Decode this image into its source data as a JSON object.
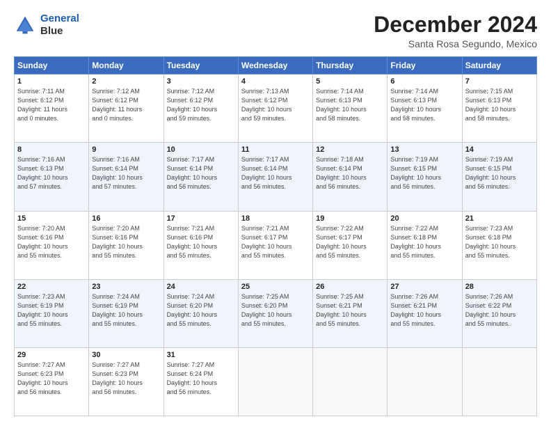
{
  "header": {
    "logo_line1": "General",
    "logo_line2": "Blue",
    "month_title": "December 2024",
    "location": "Santa Rosa Segundo, Mexico"
  },
  "days_of_week": [
    "Sunday",
    "Monday",
    "Tuesday",
    "Wednesday",
    "Thursday",
    "Friday",
    "Saturday"
  ],
  "weeks": [
    [
      {
        "day": "1",
        "info": "Sunrise: 7:11 AM\nSunset: 6:12 PM\nDaylight: 11 hours\nand 0 minutes."
      },
      {
        "day": "2",
        "info": "Sunrise: 7:12 AM\nSunset: 6:12 PM\nDaylight: 11 hours\nand 0 minutes."
      },
      {
        "day": "3",
        "info": "Sunrise: 7:12 AM\nSunset: 6:12 PM\nDaylight: 10 hours\nand 59 minutes."
      },
      {
        "day": "4",
        "info": "Sunrise: 7:13 AM\nSunset: 6:12 PM\nDaylight: 10 hours\nand 59 minutes."
      },
      {
        "day": "5",
        "info": "Sunrise: 7:14 AM\nSunset: 6:13 PM\nDaylight: 10 hours\nand 58 minutes."
      },
      {
        "day": "6",
        "info": "Sunrise: 7:14 AM\nSunset: 6:13 PM\nDaylight: 10 hours\nand 58 minutes."
      },
      {
        "day": "7",
        "info": "Sunrise: 7:15 AM\nSunset: 6:13 PM\nDaylight: 10 hours\nand 58 minutes."
      }
    ],
    [
      {
        "day": "8",
        "info": "Sunrise: 7:16 AM\nSunset: 6:13 PM\nDaylight: 10 hours\nand 57 minutes."
      },
      {
        "day": "9",
        "info": "Sunrise: 7:16 AM\nSunset: 6:14 PM\nDaylight: 10 hours\nand 57 minutes."
      },
      {
        "day": "10",
        "info": "Sunrise: 7:17 AM\nSunset: 6:14 PM\nDaylight: 10 hours\nand 56 minutes."
      },
      {
        "day": "11",
        "info": "Sunrise: 7:17 AM\nSunset: 6:14 PM\nDaylight: 10 hours\nand 56 minutes."
      },
      {
        "day": "12",
        "info": "Sunrise: 7:18 AM\nSunset: 6:14 PM\nDaylight: 10 hours\nand 56 minutes."
      },
      {
        "day": "13",
        "info": "Sunrise: 7:19 AM\nSunset: 6:15 PM\nDaylight: 10 hours\nand 56 minutes."
      },
      {
        "day": "14",
        "info": "Sunrise: 7:19 AM\nSunset: 6:15 PM\nDaylight: 10 hours\nand 56 minutes."
      }
    ],
    [
      {
        "day": "15",
        "info": "Sunrise: 7:20 AM\nSunset: 6:16 PM\nDaylight: 10 hours\nand 55 minutes."
      },
      {
        "day": "16",
        "info": "Sunrise: 7:20 AM\nSunset: 6:16 PM\nDaylight: 10 hours\nand 55 minutes."
      },
      {
        "day": "17",
        "info": "Sunrise: 7:21 AM\nSunset: 6:16 PM\nDaylight: 10 hours\nand 55 minutes."
      },
      {
        "day": "18",
        "info": "Sunrise: 7:21 AM\nSunset: 6:17 PM\nDaylight: 10 hours\nand 55 minutes."
      },
      {
        "day": "19",
        "info": "Sunrise: 7:22 AM\nSunset: 6:17 PM\nDaylight: 10 hours\nand 55 minutes."
      },
      {
        "day": "20",
        "info": "Sunrise: 7:22 AM\nSunset: 6:18 PM\nDaylight: 10 hours\nand 55 minutes."
      },
      {
        "day": "21",
        "info": "Sunrise: 7:23 AM\nSunset: 6:18 PM\nDaylight: 10 hours\nand 55 minutes."
      }
    ],
    [
      {
        "day": "22",
        "info": "Sunrise: 7:23 AM\nSunset: 6:19 PM\nDaylight: 10 hours\nand 55 minutes."
      },
      {
        "day": "23",
        "info": "Sunrise: 7:24 AM\nSunset: 6:19 PM\nDaylight: 10 hours\nand 55 minutes."
      },
      {
        "day": "24",
        "info": "Sunrise: 7:24 AM\nSunset: 6:20 PM\nDaylight: 10 hours\nand 55 minutes."
      },
      {
        "day": "25",
        "info": "Sunrise: 7:25 AM\nSunset: 6:20 PM\nDaylight: 10 hours\nand 55 minutes."
      },
      {
        "day": "26",
        "info": "Sunrise: 7:25 AM\nSunset: 6:21 PM\nDaylight: 10 hours\nand 55 minutes."
      },
      {
        "day": "27",
        "info": "Sunrise: 7:26 AM\nSunset: 6:21 PM\nDaylight: 10 hours\nand 55 minutes."
      },
      {
        "day": "28",
        "info": "Sunrise: 7:26 AM\nSunset: 6:22 PM\nDaylight: 10 hours\nand 55 minutes."
      }
    ],
    [
      {
        "day": "29",
        "info": "Sunrise: 7:27 AM\nSunset: 6:23 PM\nDaylight: 10 hours\nand 56 minutes."
      },
      {
        "day": "30",
        "info": "Sunrise: 7:27 AM\nSunset: 6:23 PM\nDaylight: 10 hours\nand 56 minutes."
      },
      {
        "day": "31",
        "info": "Sunrise: 7:27 AM\nSunset: 6:24 PM\nDaylight: 10 hours\nand 56 minutes."
      },
      {
        "day": "",
        "info": ""
      },
      {
        "day": "",
        "info": ""
      },
      {
        "day": "",
        "info": ""
      },
      {
        "day": "",
        "info": ""
      }
    ]
  ]
}
